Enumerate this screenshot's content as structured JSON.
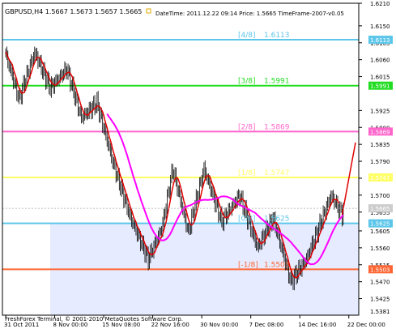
{
  "header": {
    "symbol_line": "GBPUSD,H4  1.5667 1.5673 1.5657 1.5665",
    "info_line": "DateTime: 2011.12.22 09:14   Price: 1.5665   TimeFrame-2007-v0.05",
    "footer": "FreshForex Terminal, © 2001-2010 MetaQuotes Software Corp."
  },
  "chart_data": {
    "type": "candlestick",
    "ylim": [
      1.5381,
      1.621
    ],
    "y_ticks": [
      "1.6210",
      "1.6150",
      "1.6105",
      "1.6060",
      "1.6015",
      "1.5925",
      "1.5880",
      "1.5835",
      "1.5790",
      "1.5745",
      "1.5700",
      "1.5655",
      "1.5605",
      "1.5560",
      "1.5515",
      "1.5470",
      "1.5425"
    ],
    "x_ticks": [
      {
        "label": "31 Oct 2011",
        "at": 0
      },
      {
        "label": "8 Nov 00:00",
        "at": 44
      },
      {
        "label": "15 Nov 08:00",
        "at": 88
      },
      {
        "label": "22 Nov 16:00",
        "at": 132
      },
      {
        "label": "30 Nov 00:00",
        "at": 176
      },
      {
        "label": "7 Dec 08:00",
        "at": 220
      },
      {
        "label": "14 Dec 16:00",
        "at": 264
      },
      {
        "label": "22 Dec 00:00",
        "at": 308
      }
    ],
    "bar_count": 314,
    "murrey_zone": {
      "from": 1.5381,
      "to": 1.5626,
      "color": "#e6ebff"
    },
    "levels": [
      {
        "name": "[4/8]",
        "price": 1.6113,
        "price_label": "1.6113",
        "color": "#5bc6ea"
      },
      {
        "name": "[3/8]",
        "price": 1.5991,
        "price_label": "1.5991",
        "color": "#22dd22"
      },
      {
        "name": "[2/8]",
        "price": 1.5869,
        "price_label": "1.5869",
        "color": "#ff66cc"
      },
      {
        "name": "[1/8]",
        "price": 1.5747,
        "price_label": "1.5747",
        "color": "#ffff66"
      },
      {
        "name": "[0/8]",
        "price": 1.5625,
        "price_label": "1.5625",
        "color": "#5bc6ea"
      },
      {
        "name": "[-1/8]",
        "price": 1.5503,
        "price_label": "1.5503",
        "color": "#ff6633"
      }
    ],
    "current_price": {
      "value": 1.5665,
      "label": "1.5665"
    },
    "projection": [
      [
        302,
        1.5648
      ],
      [
        314,
        1.584
      ]
    ],
    "pivots": [
      [
        0,
        1.6075
      ],
      [
        12,
        1.5955
      ],
      [
        26,
        1.608
      ],
      [
        40,
        1.5985
      ],
      [
        55,
        1.6035
      ],
      [
        68,
        1.5905
      ],
      [
        82,
        1.5945
      ],
      [
        96,
        1.579
      ],
      [
        112,
        1.564
      ],
      [
        128,
        1.553
      ],
      [
        140,
        1.561
      ],
      [
        150,
        1.577
      ],
      [
        164,
        1.56
      ],
      [
        178,
        1.577
      ],
      [
        194,
        1.563
      ],
      [
        210,
        1.57
      ],
      [
        226,
        1.556
      ],
      [
        240,
        1.564
      ],
      [
        256,
        1.547
      ],
      [
        270,
        1.553
      ],
      [
        282,
        1.562
      ],
      [
        292,
        1.57
      ],
      [
        302,
        1.5648
      ]
    ]
  }
}
